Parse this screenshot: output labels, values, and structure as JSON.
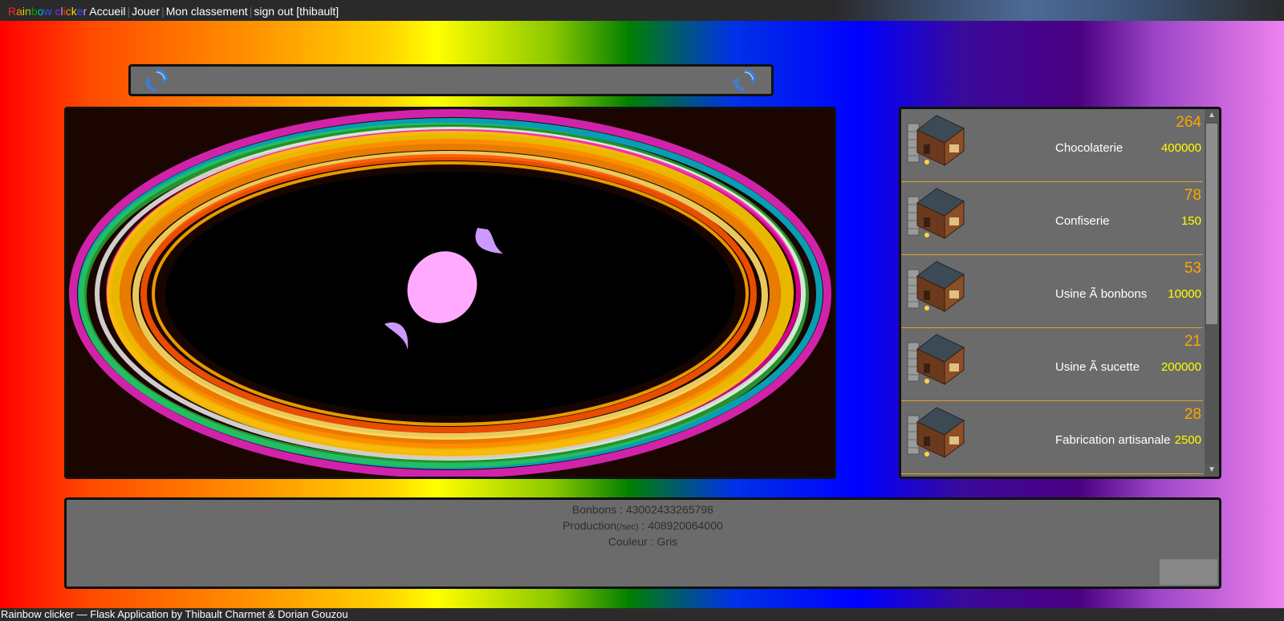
{
  "nav": {
    "brand_letters": [
      {
        "char": "R",
        "color": "#ff2020"
      },
      {
        "char": "a",
        "color": "#ff8c00"
      },
      {
        "char": "i",
        "color": "#ffd700"
      },
      {
        "char": "n",
        "color": "#9acd32"
      },
      {
        "char": "b",
        "color": "#00a000"
      },
      {
        "char": "o",
        "color": "#00bcd4"
      },
      {
        "char": "w",
        "color": "#3050ff"
      },
      {
        "char": " ",
        "color": "#ffffff"
      },
      {
        "char": "c",
        "color": "#8a2be2"
      },
      {
        "char": "l",
        "color": "#ee82ee"
      },
      {
        "char": "i",
        "color": "#ff2020"
      },
      {
        "char": "c",
        "color": "#ff8c00"
      },
      {
        "char": "k",
        "color": "#ffd700"
      },
      {
        "char": "e",
        "color": "#3050ff"
      },
      {
        "char": "r",
        "color": "#ee82ee"
      }
    ],
    "links": {
      "home": "Accueil",
      "play": "Jouer",
      "ranking": "Mon classement",
      "signout": "sign out [thibault]"
    }
  },
  "shop": {
    "items": [
      {
        "count": "264",
        "name": "Chocolaterie",
        "price": "400000"
      },
      {
        "count": "78",
        "name": "Confiserie",
        "price": "150"
      },
      {
        "count": "53",
        "name": "Usine Ã  bonbons",
        "price": "10000"
      },
      {
        "count": "21",
        "name": "Usine Ã  sucette",
        "price": "200000"
      },
      {
        "count": "28",
        "name": "Fabrication artisanale",
        "price": "2500"
      }
    ]
  },
  "stats": {
    "candies_label": "Bonbons : ",
    "candies_value": "43002433265798",
    "production_label": "Production",
    "production_unit": "(/sec)",
    "production_sep": " : ",
    "production_value": "408920064000",
    "color_label": "Couleur : ",
    "color_value": "Gris"
  },
  "footer": {
    "text": "Rainbow clicker — Flask Application by Thibault Charmet & Dorian Gouzou"
  },
  "colors": {
    "panel": "#6b6b6b",
    "count": "#ffa500",
    "price": "#ffff00",
    "candy": "#ffaaff",
    "candy_wrapper": "#cc99ff"
  },
  "icons": {
    "refresh": "refresh-icon",
    "building": "building-icon",
    "candy": "candy-icon"
  }
}
